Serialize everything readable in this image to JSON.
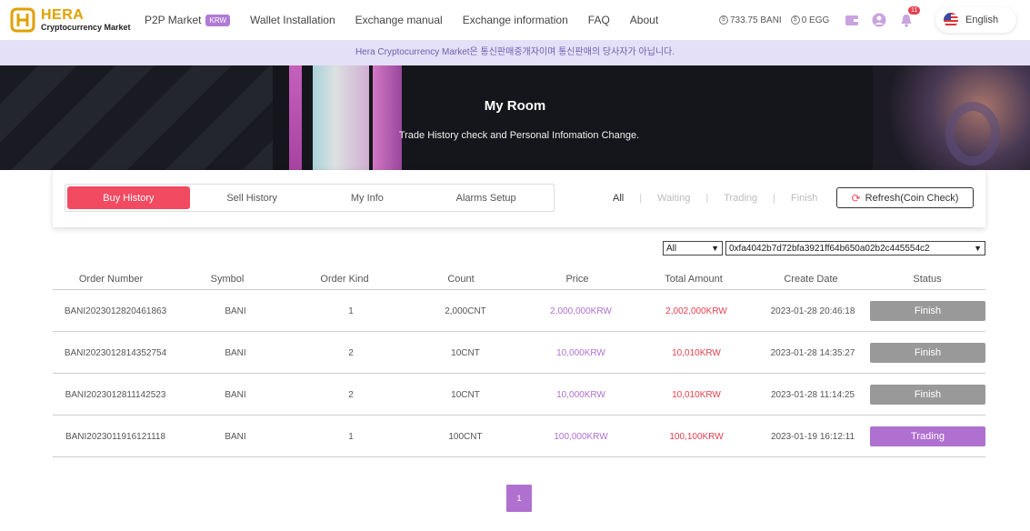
{
  "header": {
    "logo_title": "HERA",
    "logo_sub": "Cryptocurrency Market",
    "nav": [
      {
        "label": "P2P Market",
        "badge": "KRW"
      },
      {
        "label": "Wallet Installation"
      },
      {
        "label": "Exchange manual"
      },
      {
        "label": "Exchange information"
      },
      {
        "label": "FAQ"
      },
      {
        "label": "About"
      }
    ],
    "balance_bani": "733.75 BANI",
    "balance_egg": "0 EGG",
    "notification_count": "11",
    "language": "English"
  },
  "notice": "Hera Cryptocurrency Market은 통신판매중개자이며 통신판매의 당사자가 아닙니다.",
  "banner": {
    "title": "My Room",
    "subtitle": "Trade History check and Personal Infomation Change."
  },
  "tabs": [
    "Buy History",
    "Sell History",
    "My Info",
    "Alarms Setup"
  ],
  "active_tab": "Buy History",
  "filters": [
    "All",
    "Waiting",
    "Trading",
    "Finish"
  ],
  "active_filter": "All",
  "refresh_label": "Refresh(Coin Check)",
  "select_status": "All",
  "select_wallet": "0xfa4042b7d72bfa3921ff64b650a02b2c445554c2",
  "table": {
    "columns": [
      "Order Number",
      "Symbol",
      "Order Kind",
      "Count",
      "Price",
      "Total Amount",
      "Create Date",
      "Status"
    ],
    "rows": [
      {
        "order": "BANI2023012820461863",
        "symbol": "BANI",
        "kind": "1",
        "count": "2,000CNT",
        "price": "2,000,000KRW",
        "total": "2,002,000KRW",
        "date": "2023-01-28 20:46:18",
        "status": "Finish"
      },
      {
        "order": "BANI2023012814352754",
        "symbol": "BANI",
        "kind": "2",
        "count": "10CNT",
        "price": "10,000KRW",
        "total": "10,010KRW",
        "date": "2023-01-28 14:35:27",
        "status": "Finish"
      },
      {
        "order": "BANI2023012811142523",
        "symbol": "BANI",
        "kind": "2",
        "count": "10CNT",
        "price": "10,000KRW",
        "total": "10,010KRW",
        "date": "2023-01-28 11:14:25",
        "status": "Finish"
      },
      {
        "order": "BANI2023011916121118",
        "symbol": "BANI",
        "kind": "1",
        "count": "100CNT",
        "price": "100,000KRW",
        "total": "100,100KRW",
        "date": "2023-01-19 16:12:11",
        "status": "Trading"
      }
    ]
  },
  "pagination": {
    "current": "1"
  },
  "colors": {
    "accent_red": "#f24a60",
    "accent_purple": "#b070d0",
    "finish_gray": "#999999",
    "trading_purple": "#b070d0",
    "notice_bg": "#e4e0f7"
  }
}
